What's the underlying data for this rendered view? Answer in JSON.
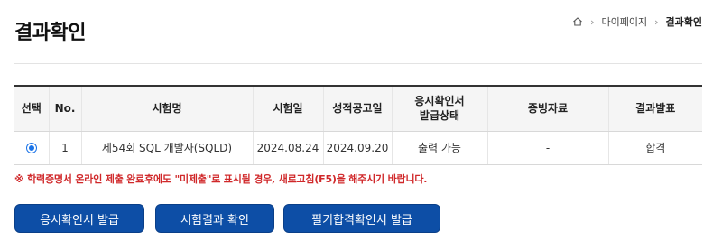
{
  "header": {
    "title": "결과확인",
    "breadcrumb": {
      "home_icon": "home-icon",
      "items": [
        "마이페이지",
        "결과확인"
      ]
    }
  },
  "table": {
    "columns": [
      "선택",
      "No.",
      "시험명",
      "시험일",
      "성적공고일",
      "응시확인서\n발급상태",
      "증빙자료",
      "결과발표"
    ],
    "rows": [
      {
        "selected": true,
        "no": "1",
        "exam_name": "제54회 SQL 개발자(SQLD)",
        "exam_date": "2024.08.24",
        "announce_date": "2024.09.20",
        "issue_status": "출력 가능",
        "evidence": "-",
        "result": "합격"
      }
    ]
  },
  "notice": "※ 학력증명서 온라인 제출 완료후에도 \"미제출\"로 표시될 경우, 새로고침(F5)을 해주시기 바랍니다.",
  "buttons": {
    "certificate": "응시확인서 발급",
    "result": "시험결과 확인",
    "written_pass": "필기합격확인서 발급"
  },
  "colors": {
    "button_bg": "#0d4ea6",
    "notice": "#d0282a",
    "radio": "#1a73e8"
  }
}
